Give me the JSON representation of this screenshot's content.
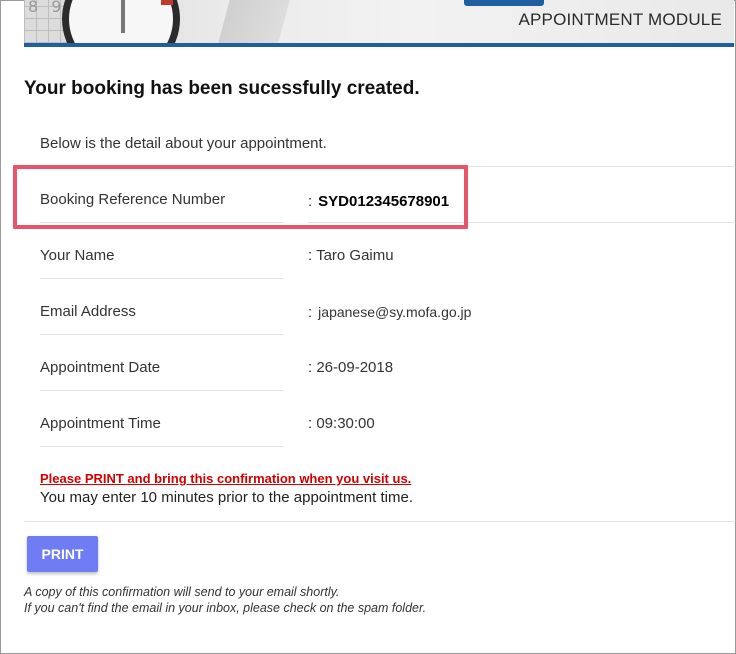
{
  "banner": {
    "module_title": "APPOINTMENT MODULE",
    "calendar_digits": "8 9"
  },
  "headline": "Your booking has been sucessfully created.",
  "intro": "Below is the detail about your appointment.",
  "details": [
    {
      "label": "Booking Reference Number",
      "value": "SYD012345678901"
    },
    {
      "label": "Your Name",
      "value": "Taro Gaimu"
    },
    {
      "label": "Email Address",
      "value": "japanese@sy.mofa.go.jp"
    },
    {
      "label": "Appointment Date",
      "value": "26-09-2018"
    },
    {
      "label": "Appointment Time",
      "value": "09:30:00"
    }
  ],
  "separator": ":",
  "warning": "Please PRINT and bring this confirmation when you visit us.",
  "enter_note": "You may enter 10 minutes prior to the appointment time.",
  "print_label": "PRINT",
  "notes": [
    "A copy of this confirmation will send to your email shortly.",
    "If you can't find the email in your inbox, please check on the spam folder."
  ],
  "colors": {
    "highlight": "#e8546a",
    "warning": "#d40000",
    "button": "#6f7cf4",
    "banner_stripe": "#1f5fa0"
  }
}
